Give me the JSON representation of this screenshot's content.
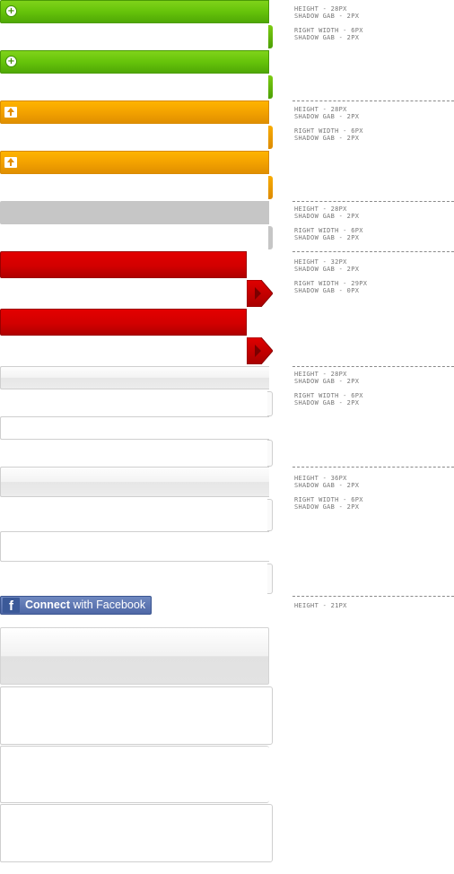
{
  "notes": {
    "green": [
      "HEIGHT - 28PX",
      "SHADOW GAB - 2PX",
      "RIGHT WIDTH - 6PX",
      "SHADOW GAB - 2PX"
    ],
    "orange": [
      "HEIGHT - 28PX",
      "SHADOW GAB - 2PX",
      "RIGHT WIDTH - 6PX",
      "SHADOW GAB - 2PX"
    ],
    "gray": [
      "HEIGHT - 28PX",
      "SHADOW GAB - 2PX",
      "RIGHT WIDTH - 6PX",
      "SHADOW GAB - 2PX"
    ],
    "red": [
      "HEIGHT - 32PX",
      "SHADOW GAB - 2PX",
      "RIGHT WIDTH - 29PX",
      "SHADOW GAB - 0PX"
    ],
    "light28": [
      "HEIGHT - 28PX",
      "SHADOW GAB - 2PX",
      "RIGHT WIDTH - 6PX",
      "SHADOW GAB - 2PX"
    ],
    "light36": [
      "HEIGHT - 36PX",
      "SHADOW GAB - 2PX",
      "RIGHT WIDTH - 6PX",
      "SHADOW GAB - 2PX"
    ],
    "facebook": [
      "HEIGHT - 21PX"
    ]
  },
  "facebook_button": {
    "logo": "f",
    "label_bold": "Connect",
    "label_rest": " with Facebook"
  },
  "icons": {
    "green": "plus-circle-icon",
    "orange": "upload-arrow-icon",
    "red": "chevron-right-icon"
  },
  "colors": {
    "green": "#66c30a",
    "orange": "#f3a200",
    "gray": "#c6c6c6",
    "red": "#d20000",
    "facebook": "#4f68a6"
  }
}
